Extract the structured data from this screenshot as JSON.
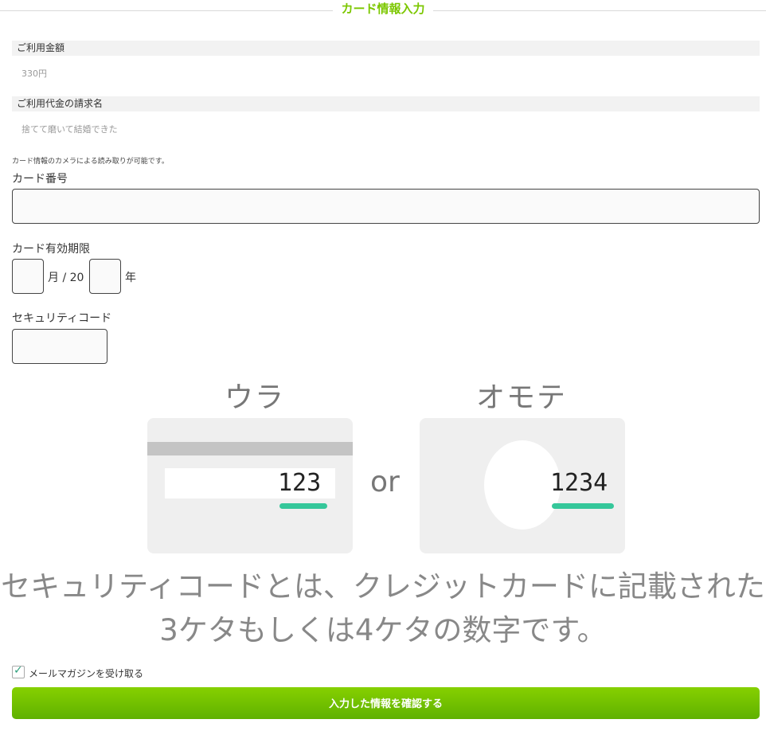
{
  "section": {
    "title": "カード情報入力"
  },
  "summary": {
    "amount_label": "ご利用金額",
    "amount_value": "330円",
    "billing_label": "ご利用代金の請求名",
    "billing_value": "捨てて磨いて結婚できた"
  },
  "note": "カード情報のカメラによる読み取りが可能です。",
  "card_number": {
    "label": "カード番号",
    "value": ""
  },
  "expiry": {
    "label": "カード有効期限",
    "month_unit": "月 / 20",
    "year_unit": "年",
    "month_value": "",
    "year_value": ""
  },
  "security": {
    "label": "セキュリティコード",
    "value": ""
  },
  "illustration": {
    "back_title": "ウラ",
    "front_title": "オモテ",
    "back_code": "123",
    "front_code": "1234",
    "or_text": "or",
    "desc_line1": "セキュリティコードとは、クレジットカードに記載された",
    "desc_line2": "3ケタもしくは4ケタの数字です。",
    "accent_color": "#35c79a"
  },
  "newsletter": {
    "label": "メールマガジンを受け取る",
    "checked": true
  },
  "submit": {
    "label": "入力した情報を確認する",
    "color": "#6cbd00"
  },
  "brand_color": "#7cc700"
}
